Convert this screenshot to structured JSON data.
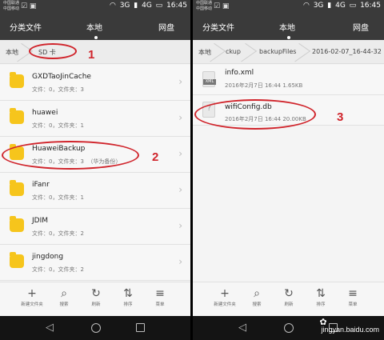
{
  "status": {
    "carrier_line1": "中国联通",
    "carrier_line2": "中国移动",
    "network_3g": "3G",
    "network_4g": "4G",
    "time": "16:45"
  },
  "tabs": [
    "分类文件",
    "本地",
    "网盘"
  ],
  "left": {
    "breadcrumb": [
      "本地",
      "SD 卡"
    ],
    "items": [
      {
        "name": "GXDTaoJinCache",
        "info": "文件：0，文件夹：3"
      },
      {
        "name": "huawei",
        "info": "文件：0，文件夹：1"
      },
      {
        "name": "HuaweiBackup",
        "info": "文件：0，文件夹：3",
        "note": "（华为备份）"
      },
      {
        "name": "iFanr",
        "info": "文件：0，文件夹：1"
      },
      {
        "name": "JDIM",
        "info": "文件：0，文件夹：2"
      },
      {
        "name": "jingdong",
        "info": "文件：0，文件夹：2"
      }
    ]
  },
  "right": {
    "breadcrumb": [
      "本地",
      "ckup",
      "backupFiles",
      "2016-02-07_16-44-32"
    ],
    "items": [
      {
        "name": "info.xml",
        "info": "2016年2月7日 16:44 1.65KB",
        "icon": "xml-file-icon",
        "tag": "XML"
      },
      {
        "name": "wifiConfig.db",
        "info": "2016年2月7日 16:44 20.00KB",
        "icon": "unknown-file-icon"
      }
    ]
  },
  "toolbar": {
    "left": [
      {
        "icon": "+",
        "label": "新建文件夹"
      },
      {
        "icon": "⌕",
        "label": "搜索"
      },
      {
        "icon": "↻",
        "label": "刷新"
      },
      {
        "icon": "⇅",
        "label": "排序"
      },
      {
        "icon": "≡",
        "label": "菜单"
      }
    ],
    "right": [
      {
        "icon": "+",
        "label": "新建文件夹"
      },
      {
        "icon": "⌕",
        "label": "搜索"
      },
      {
        "icon": "↻",
        "label": "刷新"
      },
      {
        "icon": "⇅",
        "label": "排序"
      },
      {
        "icon": "≡",
        "label": "菜单"
      }
    ]
  },
  "annotations": [
    "1",
    "2",
    "3"
  ],
  "watermark": "jingyan.baidu.com",
  "colors": {
    "accent": "#d0242b",
    "folder": "#f6c51c",
    "statusbar": "#3a3a3a"
  }
}
